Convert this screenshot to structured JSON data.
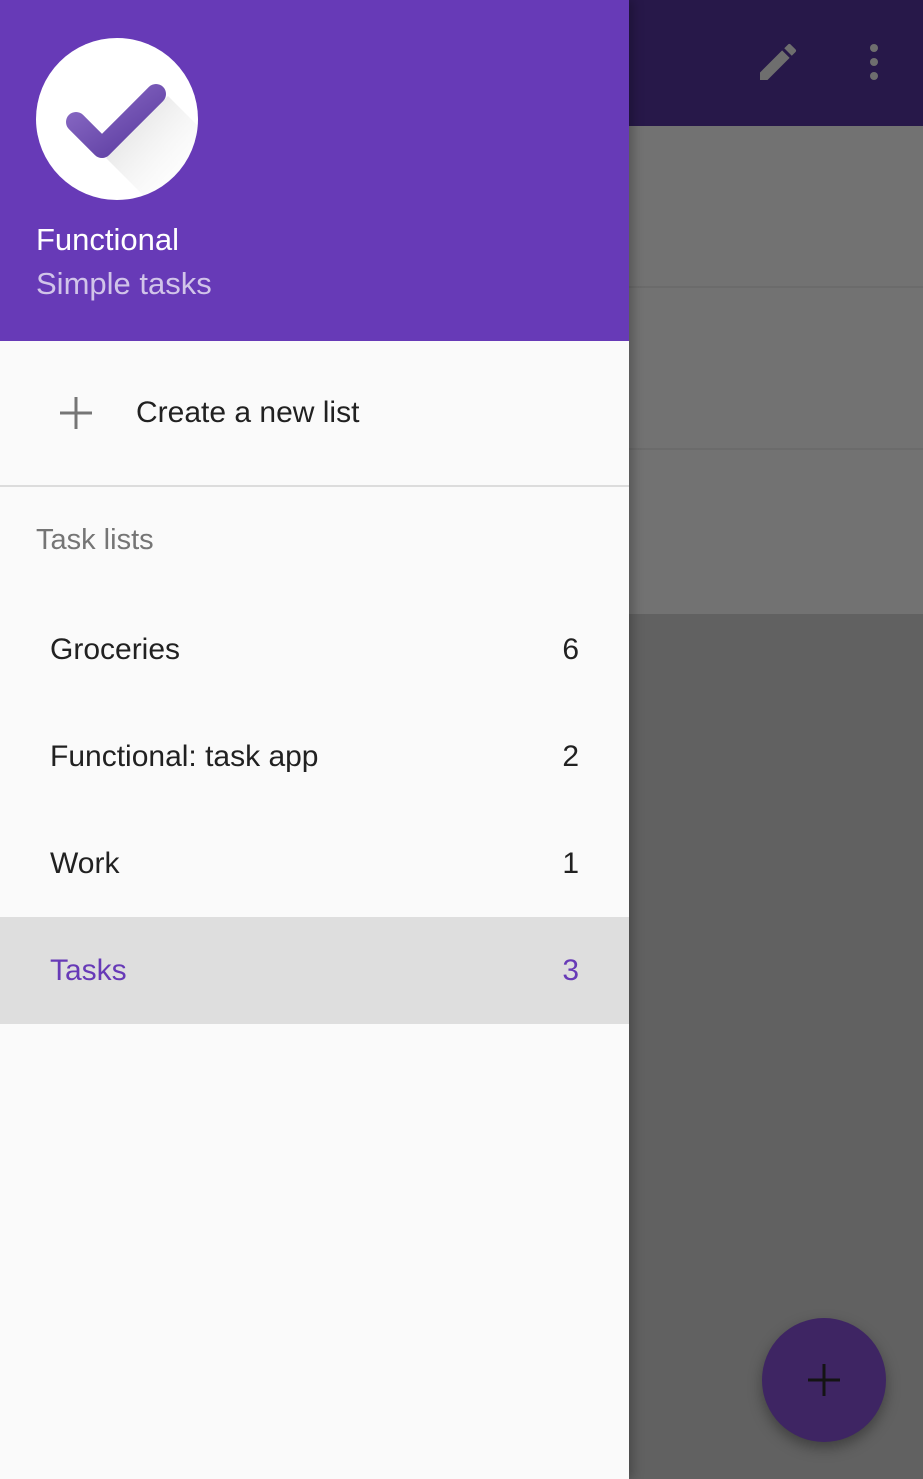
{
  "colors": {
    "primary": "#673ab7",
    "primary_light_text": "#d1c4e9",
    "selected_row_bg": "#dedede",
    "text_primary": "#212121",
    "text_secondary": "#757575"
  },
  "toolbar": {
    "actions": [
      {
        "icon": "pencil-icon"
      },
      {
        "icon": "more-vert-icon"
      }
    ]
  },
  "drawer": {
    "header": {
      "logo_icon": "checkmark-icon",
      "app_name": "Functional",
      "tagline": "Simple tasks"
    },
    "create_list": {
      "icon": "plus-icon",
      "label": "Create a new list"
    },
    "section_header": "Task lists",
    "lists": [
      {
        "name": "Groceries",
        "count": "6",
        "selected": false
      },
      {
        "name": "Functional: task app",
        "count": "2",
        "selected": false
      },
      {
        "name": "Work",
        "count": "1",
        "selected": false
      },
      {
        "name": "Tasks",
        "count": "3",
        "selected": true
      }
    ]
  },
  "fab": {
    "icon": "plus-icon"
  }
}
